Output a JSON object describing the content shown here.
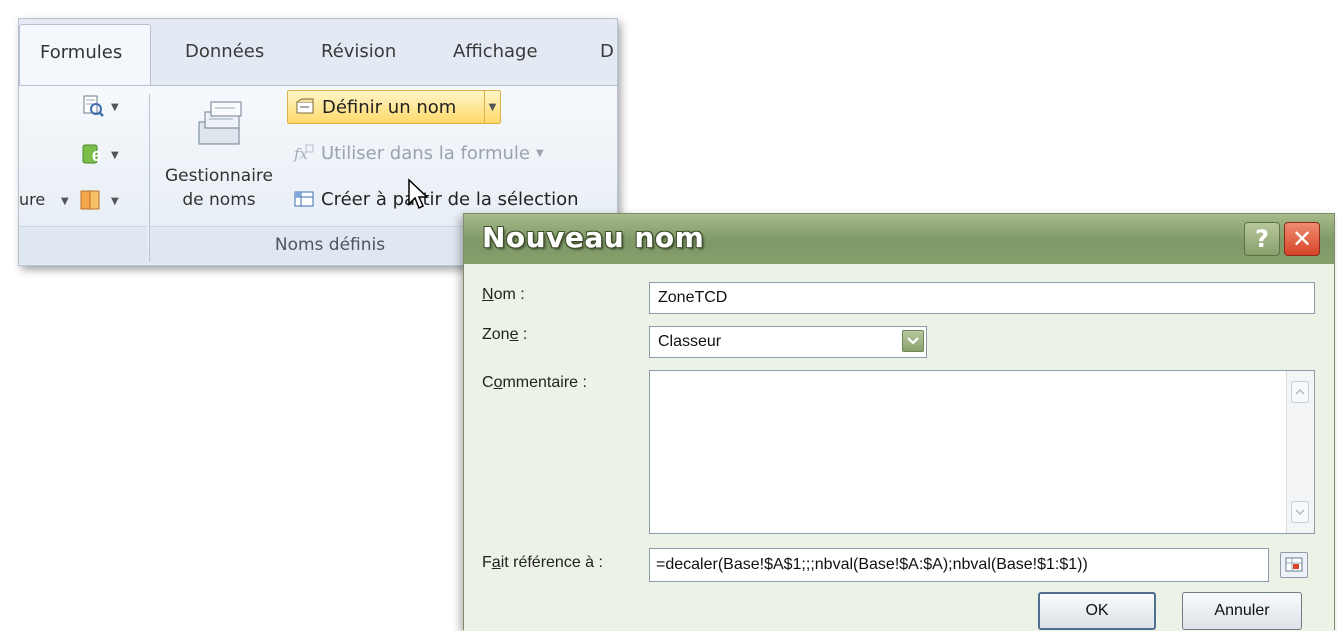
{
  "ribbon": {
    "tabs": [
      "Formules",
      "Données",
      "Révision",
      "Affichage",
      "D"
    ],
    "left_group_partial_label": "ure",
    "gestionnaire": {
      "line1": "Gestionnaire",
      "line2": "de noms"
    },
    "commands": {
      "define_name": "Définir un nom",
      "use_in_formula": "Utiliser dans la formule",
      "create_from_selection": "Créer à partir de la sélection"
    },
    "group_label": "Noms définis"
  },
  "dialog": {
    "title": "Nouveau nom",
    "help_symbol": "?",
    "close_symbol": "✕",
    "labels": {
      "name": {
        "pre": "",
        "ul": "N",
        "post": "om :"
      },
      "zone": {
        "pre": "Zon",
        "ul": "e",
        "post": " :"
      },
      "comment": {
        "pre": "C",
        "ul": "o",
        "post": "mmentaire :"
      },
      "refers_to": {
        "pre": "F",
        "ul": "a",
        "post": "it référence à :"
      }
    },
    "name_value": "ZoneTCD",
    "zone_value": "Classeur",
    "comment_value": "",
    "refers_to_value": "=decaler(Base!$A$1;;;nbval(Base!$A:$A);nbval(Base!$1:$1))",
    "ok_label": "OK",
    "cancel_label": "Annuler"
  },
  "colors": {
    "dialog_title_green": "#7f9866",
    "close_red": "#d6452a",
    "highlight_yellow": "#ffd96b"
  }
}
